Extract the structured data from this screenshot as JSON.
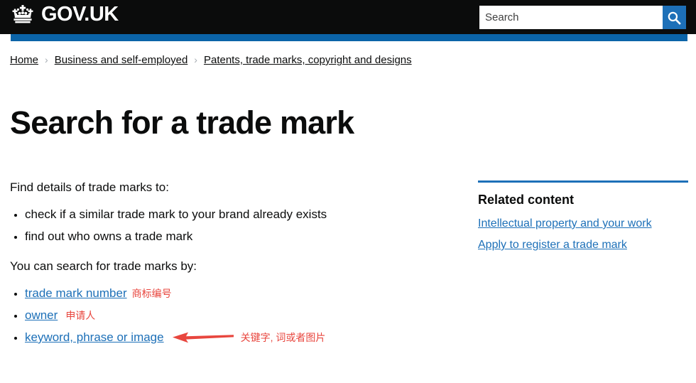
{
  "header": {
    "brand_label": "GOV.UK",
    "crown_icon": "crown-icon",
    "search": {
      "placeholder": "Search",
      "value": "",
      "button_icon": "search-icon"
    },
    "accent_black": "#0b0c0c",
    "accent_blue": "#1d70b8"
  },
  "breadcrumb": {
    "separator": "›",
    "items": [
      {
        "label": "Home"
      },
      {
        "label": "Business and self-employed"
      },
      {
        "label": "Patents, trade marks, copyright and designs"
      }
    ]
  },
  "page": {
    "title": "Search for a trade mark"
  },
  "main": {
    "intro_1": "Find details of trade marks to:",
    "list_1": [
      "check if a similar trade mark to your brand already exists",
      "find out who owns a trade mark"
    ],
    "intro_2": "You can search for trade marks by:",
    "list_2": [
      {
        "link": "trade mark number",
        "note": "商标编号"
      },
      {
        "link": "owner",
        "note": "申请人"
      },
      {
        "link": "keyword, phrase or image",
        "note": "关键字, 词或者图片"
      }
    ],
    "annotation_color": "#e8463e",
    "arrow_icon": "left-arrow-annotation-icon"
  },
  "related": {
    "title": "Related content",
    "links": [
      "Intellectual property and your work",
      "Apply to register a trade mark"
    ]
  }
}
